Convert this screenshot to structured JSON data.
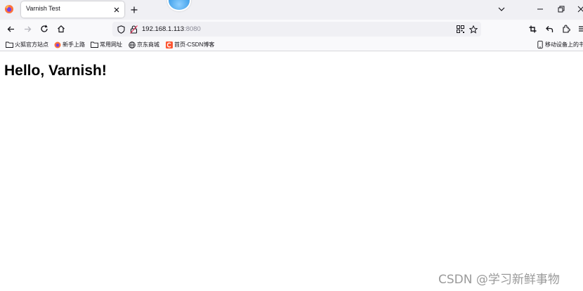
{
  "browser": {
    "tab": {
      "title": "Varnish Test"
    },
    "url": {
      "host": "192.168.1.113",
      "port": ":8080"
    }
  },
  "bookmarks": [
    {
      "label": "火狐官方站点",
      "icon": "folder-icon"
    },
    {
      "label": "新手上路",
      "icon": "firefox-icon"
    },
    {
      "label": "常用网址",
      "icon": "folder-icon"
    },
    {
      "label": "京东商城",
      "icon": "globe-icon"
    },
    {
      "label": "首页-CSDN博客",
      "icon": "csdn-icon"
    }
  ],
  "mobile_bookmarks": {
    "label": "移动设备上的书",
    "icon": "mobile-icon"
  },
  "page": {
    "heading": "Hello, Varnish!"
  },
  "watermark": {
    "text": "CSDN @学习新鲜事物"
  },
  "colors": {
    "csdn_red": "#fc5531",
    "firefox_orange": "#ff7139"
  }
}
